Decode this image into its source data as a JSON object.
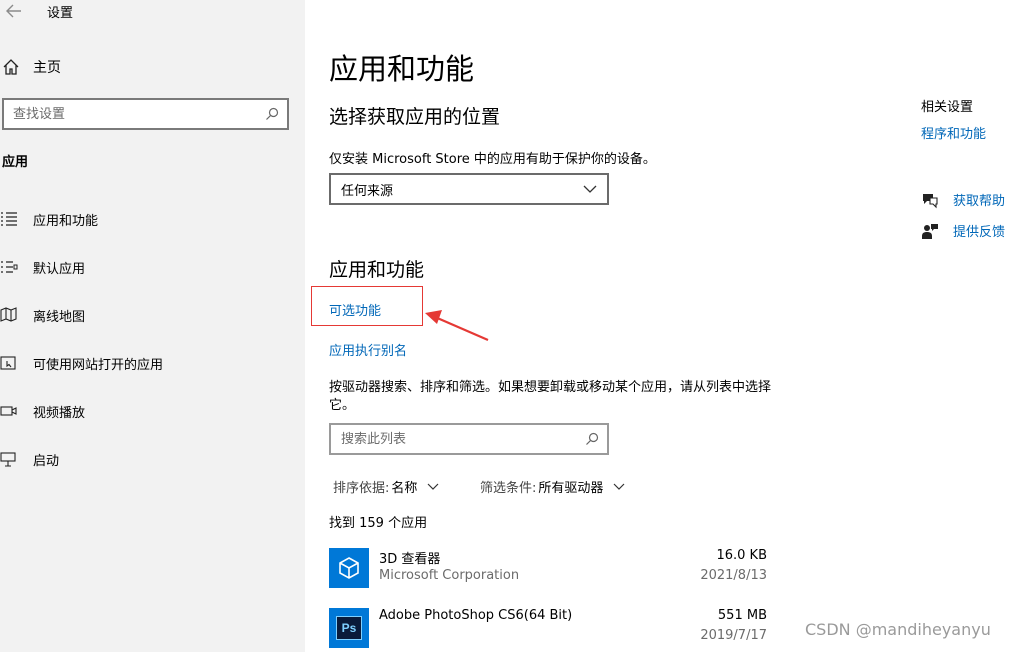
{
  "window": {
    "title": "设置"
  },
  "sidebar": {
    "home": "主页",
    "search_placeholder": "查找设置",
    "section": "应用",
    "items": [
      {
        "label": "应用和功能",
        "icon": "list-icon"
      },
      {
        "label": "默认应用",
        "icon": "default-apps-icon"
      },
      {
        "label": "离线地图",
        "icon": "map-icon"
      },
      {
        "label": "可使用网站打开的应用",
        "icon": "web-app-icon"
      },
      {
        "label": "视频播放",
        "icon": "video-icon"
      },
      {
        "label": "启动",
        "icon": "startup-icon"
      }
    ]
  },
  "main": {
    "title": "应用和功能",
    "source": {
      "heading": "选择获取应用的位置",
      "description": "仅安装 Microsoft Store 中的应用有助于保护你的设备。",
      "selected": "任何来源"
    },
    "features": {
      "heading": "应用和功能",
      "optional_link": "可选功能",
      "alias_link": "应用执行别名",
      "description": "按驱动器搜索、排序和筛选。如果想要卸载或移动某个应用，请从列表中选择它。",
      "search_placeholder": "搜索此列表",
      "sort_label": "排序依据:",
      "sort_value": "名称",
      "filter_label": "筛选条件:",
      "filter_value": "所有驱动器",
      "found": "找到 159 个应用"
    },
    "apps": [
      {
        "name": "3D 查看器",
        "publisher": "Microsoft Corporation",
        "size": "16.0 KB",
        "date": "2021/8/13",
        "icon_color": "#0078d7"
      },
      {
        "name": "Adobe PhotoShop CS6(64 Bit)",
        "publisher": "",
        "size": "551 MB",
        "date": "2019/7/17",
        "icon_color": "#0078d7"
      }
    ]
  },
  "right": {
    "related_title": "相关设置",
    "related_link": "程序和功能",
    "help": "获取帮助",
    "feedback": "提供反馈"
  },
  "watermark": "CSDN @mandiheyanyu",
  "colors": {
    "link": "#0067b8",
    "sidebar_bg": "#f2f2f2",
    "annotation": "#e53935"
  }
}
